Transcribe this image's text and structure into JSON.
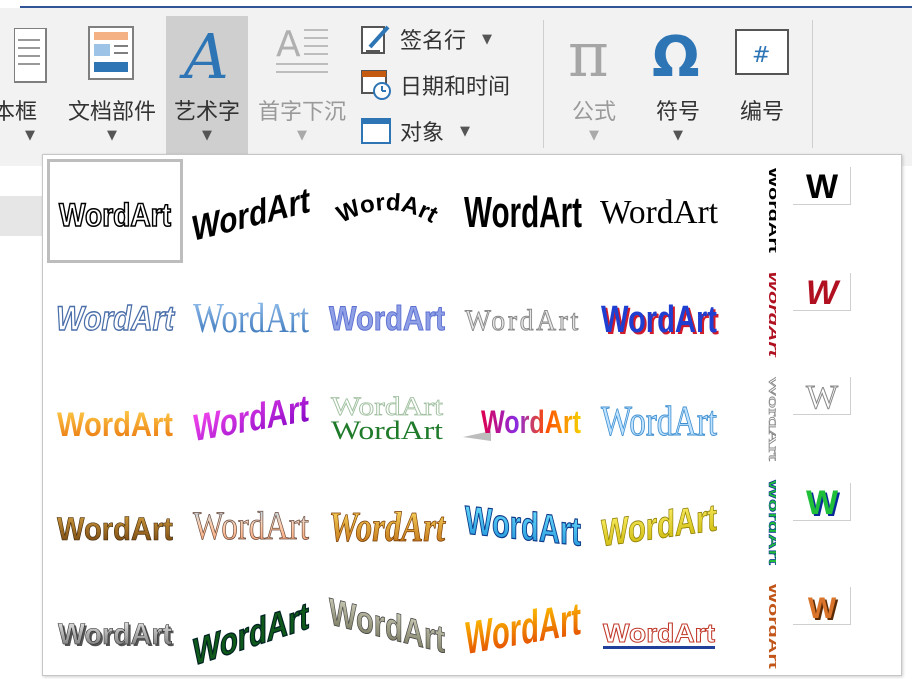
{
  "ribbon": {
    "textbox_label": "本框",
    "quickparts_label": "文档部件",
    "wordart_label": "艺术字",
    "dropcap_label": "首字下沉",
    "signature_label": "签名行",
    "datetime_label": "日期和时间",
    "object_label": "对象",
    "equation_label": "公式",
    "symbol_label": "符号",
    "number_label": "编号"
  },
  "gallery": {
    "sample_text": "WordArt",
    "vertical_text": "WordArt",
    "letter": "W"
  },
  "colors": {
    "ribbon_bg": "#f2f2f2",
    "accent_blue": "#2f5597",
    "selected_bg": "#cfcfcf"
  }
}
